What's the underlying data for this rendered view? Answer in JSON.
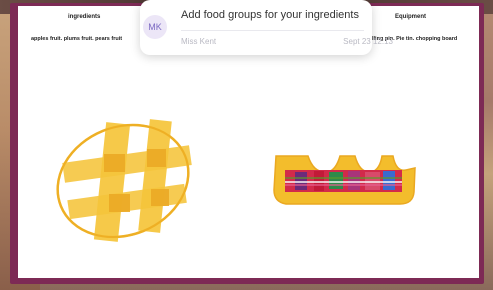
{
  "worksheet": {
    "ingredients_heading": "ingredients",
    "equipment_heading": "Equipment",
    "ingredients_list": "apples fruit. plums fruit. pears fruit",
    "equipment_list": "lling pin. Pie tin. chopping board"
  },
  "notification": {
    "avatar_initials": "MK",
    "title": "Add food groups for your ingredients",
    "sender": "Miss Kent",
    "timestamp": "Sept 23 12:13"
  },
  "colors": {
    "frame": "#7d2a55",
    "pie_yellow": "#f5c02a",
    "avatar_bg": "#ece6f7",
    "avatar_text": "#7b68c2"
  }
}
